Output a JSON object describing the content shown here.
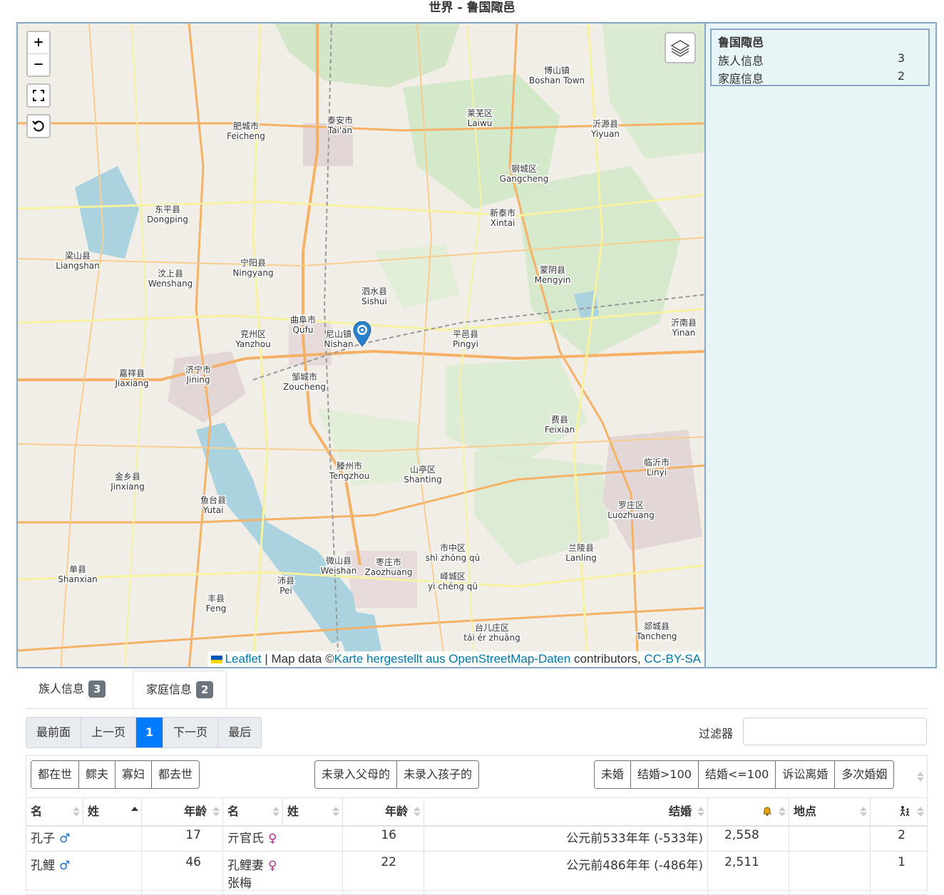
{
  "page_title": "世界 - 鲁国陬邑",
  "map": {
    "labels": [
      {
        "zh": "泰安市",
        "py": "Tai'an"
      },
      {
        "zh": "莱芜区",
        "py": "Laiwu"
      },
      {
        "zh": "肥城市",
        "py": "Feicheng"
      },
      {
        "zh": "钢城区",
        "py": "Gangcheng"
      },
      {
        "zh": "宁阳县",
        "py": "Ningyang"
      },
      {
        "zh": "新泰市",
        "py": "Xintai"
      },
      {
        "zh": "泗水县",
        "py": "Sishui"
      },
      {
        "zh": "蒙阴县",
        "py": "Mengyin"
      },
      {
        "zh": "曲阜市",
        "py": "Qufu"
      },
      {
        "zh": "兖州区",
        "py": "Yanzhou"
      },
      {
        "zh": "平邑县",
        "py": "Pingyi"
      },
      {
        "zh": "济宁市",
        "py": "Jining"
      },
      {
        "zh": "邹城市",
        "py": "Zoucheng"
      },
      {
        "zh": "嘉祥县",
        "py": "Jiaxiang"
      },
      {
        "zh": "费县",
        "py": "Feixian"
      },
      {
        "zh": "临沂市",
        "py": "Linyi"
      },
      {
        "zh": "滕州市",
        "py": "Tengzhou"
      },
      {
        "zh": "山亭区",
        "py": "Shanting"
      },
      {
        "zh": "鱼台县",
        "py": "Yutai"
      },
      {
        "zh": "金乡县",
        "py": "Jinxiang"
      },
      {
        "zh": "微山县",
        "py": "Weishan"
      },
      {
        "zh": "枣庄市",
        "py": "Zaozhuang"
      },
      {
        "zh": "罗庄区",
        "py": "Luozhuang"
      },
      {
        "zh": "兰陵县",
        "py": "Lanling"
      },
      {
        "zh": "峄城区",
        "py": "yì chéng qū"
      },
      {
        "zh": "沛县",
        "py": "Pei"
      },
      {
        "zh": "单县",
        "py": "Shanxian"
      },
      {
        "zh": "郯城县",
        "py": "Tancheng"
      },
      {
        "zh": "台儿庄区",
        "py": "tái ér zhuāng"
      },
      {
        "zh": "梁山县",
        "py": "Liangshan"
      },
      {
        "zh": "汶上县",
        "py": "Wenshang"
      },
      {
        "zh": "东平县",
        "py": "Dongping"
      },
      {
        "zh": "沂源县",
        "py": "Yiyuan"
      },
      {
        "zh": "沂南县",
        "py": "Yinan"
      },
      {
        "zh": "尼山镇",
        "py": "Nishan"
      },
      {
        "zh": "丰县",
        "py": "Feng"
      },
      {
        "zh": "市中区",
        "py": "shì zhōng qū"
      },
      {
        "zh": "博山镇",
        "py": "Boshan Town"
      }
    ],
    "zoom_in": "+",
    "zoom_out": "−",
    "fullscreen_icon": "fullscreen-icon",
    "reset_icon": "reset-view-icon",
    "layers_icon": "layers-icon",
    "marker_icon": "map-marker-icon",
    "attribution": {
      "leaflet": "Leaflet",
      "sep": " | Map data ©",
      "osm": "Karte hergestellt aus OpenStreetMap-Daten",
      "contrib": " contributors, ",
      "license": "CC-BY-SA"
    }
  },
  "legend": {
    "title": "鲁国陬邑",
    "rows": [
      {
        "label": "族人信息",
        "value": "3"
      },
      {
        "label": "家庭信息",
        "value": "2"
      }
    ]
  },
  "tabs": [
    {
      "label": "族人信息",
      "count": "3"
    },
    {
      "label": "家庭信息",
      "count": "2"
    }
  ],
  "pager": {
    "first": "最前面",
    "prev": "上一页",
    "current": "1",
    "next": "下一页",
    "last": "最后"
  },
  "filter": {
    "label": "过滤器",
    "value": ""
  },
  "filter_buttons": {
    "group1": [
      "都在世",
      "鳏夫",
      "寡妇",
      "都去世"
    ],
    "group2": [
      "未录入父母的",
      "未录入孩子的"
    ],
    "group3": [
      "未婚",
      "结婚>100",
      "结婚<=100",
      "诉讼离婚",
      "多次婚姻"
    ]
  },
  "table": {
    "headers": {
      "given1": "名",
      "surname1": "姓",
      "age1": "年龄",
      "given2": "名",
      "surname2": "姓",
      "age2": "年龄",
      "marriage": "结婚",
      "bell_icon": "anniversary-icon",
      "place": "地点",
      "children_icon": "children-icon"
    },
    "rows": [
      {
        "given1": "孔子",
        "sex1": "♂",
        "age1": "17",
        "given2": "亓官氏",
        "sex2": "♀",
        "age2": "16",
        "marriage": "公元前533年年",
        "marriage_paren": "(-533年)",
        "years": "2,558",
        "place": "",
        "children": "2"
      },
      {
        "given1": "孔鲤",
        "sex1": "♂",
        "age1": "46",
        "given2": "孔鲤妻",
        "given2b": "张梅",
        "sex2": "♀",
        "age2": "22",
        "marriage": "公元前486年年",
        "marriage_paren": "(-486年)",
        "years": "2,511",
        "place": "",
        "children": "1"
      }
    ]
  },
  "colors": {
    "accent": "#007bff",
    "map_border": "#8aa6c6",
    "panel_bg": "#e8f5f7",
    "male": "#1f6fd1",
    "female": "#b0308a"
  }
}
